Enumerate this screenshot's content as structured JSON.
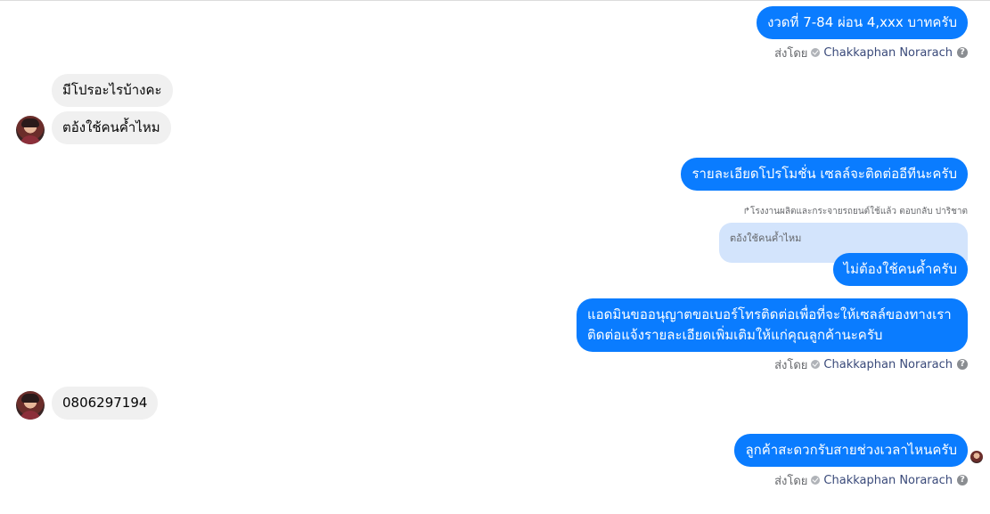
{
  "conversation": {
    "messages": [
      {
        "text": "งวดที่ 7-84 ผ่อน 4,xxx บาทครับ"
      },
      {
        "text": "มีโปรอะไรบ้างคะ"
      },
      {
        "text": "ตอ้งใช้คนค้ำไหม"
      },
      {
        "text": "รายละเอียดโปรโมชั่น เซลล์จะติดต่ออีทีนะครับ"
      },
      {
        "text": "ไม่ต้องใช้คนค้ำครับ"
      },
      {
        "line1": "แอดมินขออนุญาตขอเบอร์โทรติดต่อเพื่อที่จะให้เซลล์ของทางเรา",
        "line2": "ติดต่อแจ้งรายละเอียดเพิ่มเติมให้แก่คุณลูกค้านะครับ"
      },
      {
        "text": "0806297194"
      },
      {
        "text": "ลูกค้าสะดวกรับสายช่วงเวลาไหนครับ"
      }
    ],
    "sent_by": {
      "prefix": "ส่งโดย",
      "name": "Chakkaphan Norarach",
      "help": "?"
    },
    "reply": {
      "label": "โรงงานผลิตและกระจายรถยนต์ใช้แล้ว ตอบกลับ ปาริชาต",
      "quoted": "ตอ้งใช้คนค้ำไหม"
    }
  },
  "colors": {
    "outgoing": "#0a7cff",
    "incoming": "#f0f0f0",
    "reply_quote": "#d3e4fc"
  },
  "icons": {
    "verified": "check-circle-icon",
    "help": "question-circle-icon"
  }
}
